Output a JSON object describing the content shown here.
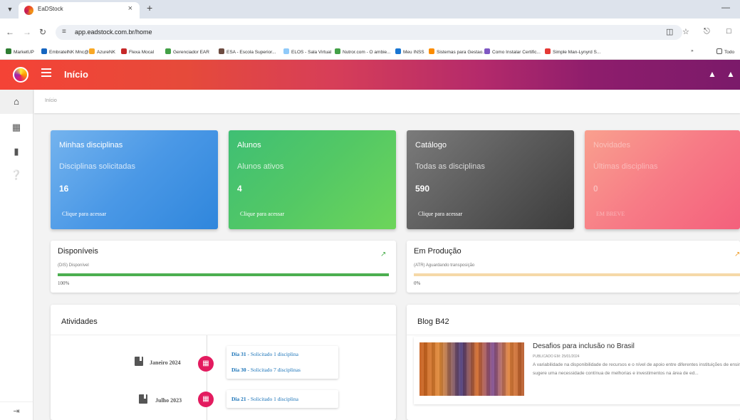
{
  "browser": {
    "tab_title": "EaDStock",
    "tab_close": "×",
    "new_tab": "+",
    "url": "app.eadstock.com.br/home",
    "bookmarks": [
      {
        "label": "MarketUP",
        "color": "#2e7d32"
      },
      {
        "label": "EmbratelNK Mnc@#",
        "color": "#1565c0"
      },
      {
        "label": "AzureNK",
        "color": "#f9a825"
      },
      {
        "label": "Flexa Mocal",
        "color": "#c62828"
      },
      {
        "label": "Gerenciador EAR",
        "color": "#43a047"
      },
      {
        "label": "ESA - Escola Superior...",
        "color": "#6d4c41"
      },
      {
        "label": "ELOS - Sala Virtual",
        "color": "#90caf9"
      },
      {
        "label": "Nutror.com - O ambie...",
        "color": "#43a047"
      },
      {
        "label": "Meu INSS",
        "color": "#1976d2"
      },
      {
        "label": "Sistemas para Gestao...",
        "color": "#fb8c00"
      },
      {
        "label": "Como Instalar Certific...",
        "color": "#7e57c2"
      },
      {
        "label": "Simple Man-Lynyrd S...",
        "color": "#e53935"
      }
    ],
    "more_bookmarks": "»",
    "all_bookmarks": "Todo"
  },
  "header": {
    "title": "Início"
  },
  "breadcrumb": "Início",
  "stat_cards": [
    {
      "title": "Minhas disciplinas",
      "subtitle": "Disciplinas solicitadas",
      "count": "16",
      "link": "Clique para acessar"
    },
    {
      "title": "Alunos",
      "subtitle": "Alunos ativos",
      "count": "4",
      "link": "Clique para acessar"
    },
    {
      "title": "Catálogo",
      "subtitle": "Todas as disciplinas",
      "count": "590",
      "link": "Clique para acessar"
    },
    {
      "title": "Novidades",
      "subtitle": "Últimas disciplinas",
      "count": "0",
      "link": "EM BREVE"
    }
  ],
  "progress_cards": [
    {
      "title": "Disponíveis",
      "subtitle": "(DIS) Disponível",
      "percent_label": "100%",
      "progress": 1.0,
      "color": "#4caf50"
    },
    {
      "title": "Em Produção",
      "subtitle": "(ATR) Aguardando transposição",
      "percent_label": "0%",
      "progress": 0.0,
      "color": "#f5d9a8"
    }
  ],
  "activities": {
    "title": "Atividades",
    "groups": [
      {
        "month": "Janeiro 2024",
        "entries": [
          {
            "day": "Dia 31",
            "text": " - Solicitado 1 disciplina"
          },
          {
            "day": "Dia 30",
            "text": " - Solicitado 7 disciplinas"
          }
        ]
      },
      {
        "month": "Julho 2023",
        "entries": [
          {
            "day": "Dia 21",
            "text": " - Solicitado 1 disciplina"
          }
        ]
      }
    ]
  },
  "blog": {
    "title": "Blog B42",
    "post": {
      "title": "Desafios para inclusão no Brasil",
      "date": "PUBLICADO EM: 25/01/2024",
      "excerpt": "A variabilidade na disponibilidade de recursos e o nível de apoio entre diferentes instituições de ensino sugere uma necessidade contínua de melhorias e investimentos na área de ed..."
    }
  }
}
